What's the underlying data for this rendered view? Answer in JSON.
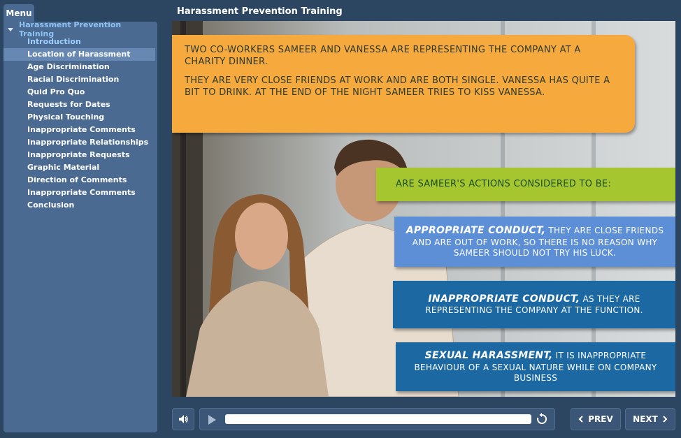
{
  "menu": {
    "tab_label": "Menu",
    "course_title": "Harassment Prevention Training",
    "items": [
      {
        "label": "Introduction",
        "state": "visited"
      },
      {
        "label": "Location of Harassment",
        "state": "active"
      },
      {
        "label": "Age Discrimination",
        "state": "normal"
      },
      {
        "label": "Racial Discrimination",
        "state": "normal"
      },
      {
        "label": "Quid Pro Quo",
        "state": "normal"
      },
      {
        "label": "Requests for Dates",
        "state": "normal"
      },
      {
        "label": "Physical Touching",
        "state": "normal"
      },
      {
        "label": "Inappropriate Comments",
        "state": "normal"
      },
      {
        "label": "Inappropriate Relationships",
        "state": "normal"
      },
      {
        "label": "Inappropriate Requests",
        "state": "normal"
      },
      {
        "label": "Graphic Material",
        "state": "normal"
      },
      {
        "label": "Direction of Comments",
        "state": "normal"
      },
      {
        "label": "Inappropriate Comments",
        "state": "normal"
      },
      {
        "label": "Conclusion",
        "state": "normal"
      }
    ]
  },
  "header": {
    "title": "Harassment Prevention Training"
  },
  "slide": {
    "scenario_lines": [
      "Two co-workers Sameer and Vanessa are representing the company at a charity dinner.",
      "They are very close friends at work and are both single. Vanessa has quite a bit to drink. At the end of the night Sameer tries to kiss Vanessa."
    ],
    "question": "Are Sameer's actions considered to be:",
    "options": [
      {
        "term": "Appropriate Conduct,",
        "text": "they are close friends and are out of work, so there is no reason why Sameer should not try his luck."
      },
      {
        "term": "Inappropriate Conduct,",
        "text": "as they are representing the company at the function."
      },
      {
        "term": "Sexual Harassment,",
        "text": "it is inappropriate behaviour of a sexual nature while on company business"
      }
    ]
  },
  "controls": {
    "prev_label": "PREV",
    "next_label": "NEXT",
    "progress": 0
  },
  "colors": {
    "scenario_bg": "#f6a93c",
    "question_bg": "#a5c62e",
    "option_light_bg": "#5d8fd7",
    "option_dark_bg": "#1b68a3",
    "sidebar_bg": "#4a6a92",
    "active_item_bg": "#6788b2"
  },
  "icons": {
    "volume": "speaker-icon",
    "play": "play-icon",
    "replay": "replay-icon",
    "prev": "chevron-left-icon",
    "next": "chevron-right-icon",
    "expand": "triangle-down-icon"
  }
}
